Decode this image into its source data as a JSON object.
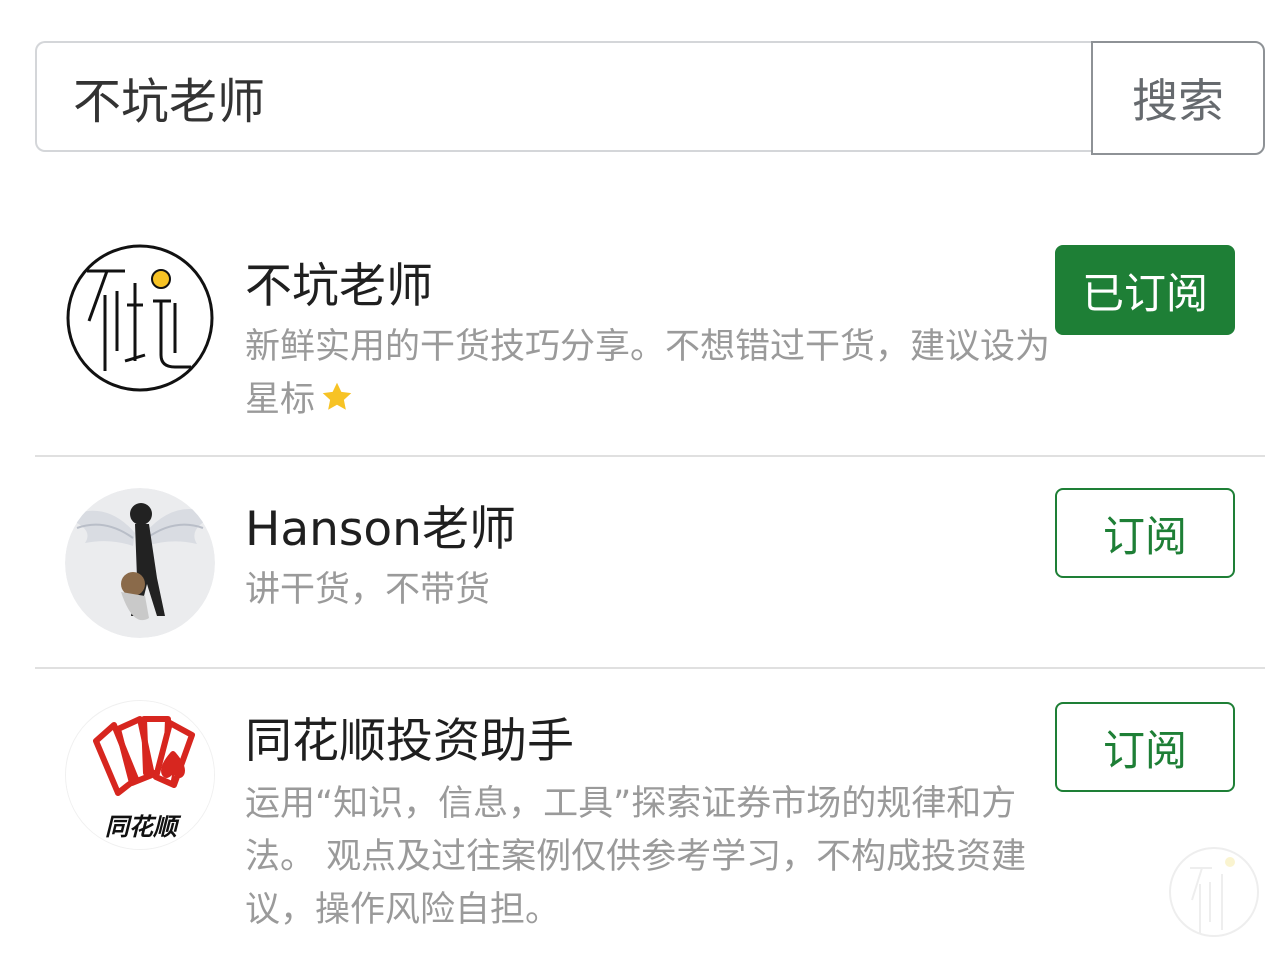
{
  "search": {
    "value": "不坑老师",
    "button_label": "搜索"
  },
  "results": [
    {
      "title": "不坑老师",
      "description": "新鲜实用的干货技巧分享。不想错过干货，建议设为星标",
      "button_label": "已订阅",
      "subscribed": true,
      "avatar_icon": "bukeng-logo-icon"
    },
    {
      "title": "Hanson老师",
      "description": "讲干货，不带货",
      "button_label": "订阅",
      "subscribed": false,
      "avatar_icon": "anime-angel-avatar"
    },
    {
      "title": "同花顺投资助手",
      "description": "运用“知识，信息，工具”探索证券市场的规律和方法。 观点及过往案例仅供参考学习，不构成投资建议，操作风险自担。",
      "button_label": "订阅",
      "subscribed": false,
      "avatar_icon": "tonghuashun-logo-icon",
      "avatar_text": "同花顺"
    }
  ],
  "colors": {
    "accent_green": "#1e7f36",
    "star_yellow": "#f7c325",
    "logo_red": "#d7261f"
  }
}
